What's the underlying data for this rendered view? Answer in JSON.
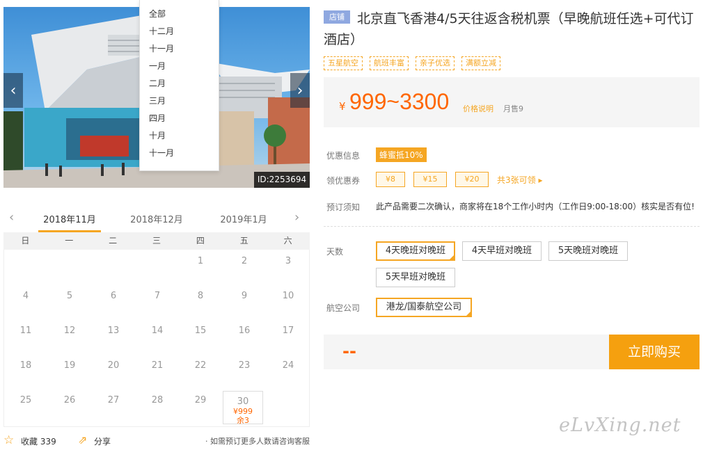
{
  "gallery": {
    "product_id": "ID:2253694"
  },
  "month_menu": {
    "items": [
      "全部",
      "十二月",
      "十一月",
      "一月",
      "二月",
      "三月",
      "四月",
      "十月",
      "十一月"
    ]
  },
  "calendar": {
    "months": [
      "2018年11月",
      "2018年12月",
      "2019年1月"
    ],
    "active_month": "2018年11月",
    "weekdays": [
      "日",
      "一",
      "二",
      "三",
      "四",
      "五",
      "六"
    ],
    "days": [
      "1",
      "2",
      "3",
      "4",
      "5",
      "6",
      "7",
      "8",
      "9",
      "10",
      "11",
      "12",
      "13",
      "14",
      "15",
      "16",
      "17",
      "18",
      "19",
      "20",
      "21",
      "22",
      "23",
      "24",
      "25",
      "26",
      "27",
      "28",
      "29",
      "30"
    ],
    "selected_day": {
      "day": "30",
      "price": "¥999",
      "stock": "余3"
    }
  },
  "bottom": {
    "favorite_label": "收藏",
    "favorite_count": "339",
    "share_label": "分享",
    "consult": "· 如需预订更多人数请咨询客服"
  },
  "product": {
    "shop_badge": "店铺",
    "title": "北京直飞香港4/5天往返含税机票（早晚航班任选+可代订酒店）",
    "tags": [
      "五星航空",
      "航班丰富",
      "亲子优选",
      "满额立减"
    ],
    "price": {
      "currency": "¥",
      "amount": "999~3300",
      "note": "价格说明",
      "sold": "月售9"
    }
  },
  "info": {
    "promo_label": "优惠信息",
    "promo_value": "蜂蜜抵10%",
    "coupon_label": "领优惠券",
    "coupons": [
      "¥8",
      "¥15",
      "¥20"
    ],
    "coupon_more": "共3张可领 ▸",
    "notice_label": "预订须知",
    "notice_value": "此产品需要二次确认，商家将在18个工作小时内（工作日9:00-18:00）核实是否有位!"
  },
  "options": {
    "days_label": "天数",
    "days": [
      "4天晚班对晚班",
      "4天早班对晚班",
      "5天晚班对晚班",
      "5天早班对晚班"
    ],
    "airline_label": "航空公司",
    "airlines": [
      "港龙/国泰航空公司"
    ]
  },
  "purchase": {
    "total": "--",
    "buy_label": "立即购买"
  },
  "watermark": "eLvXing.net"
}
